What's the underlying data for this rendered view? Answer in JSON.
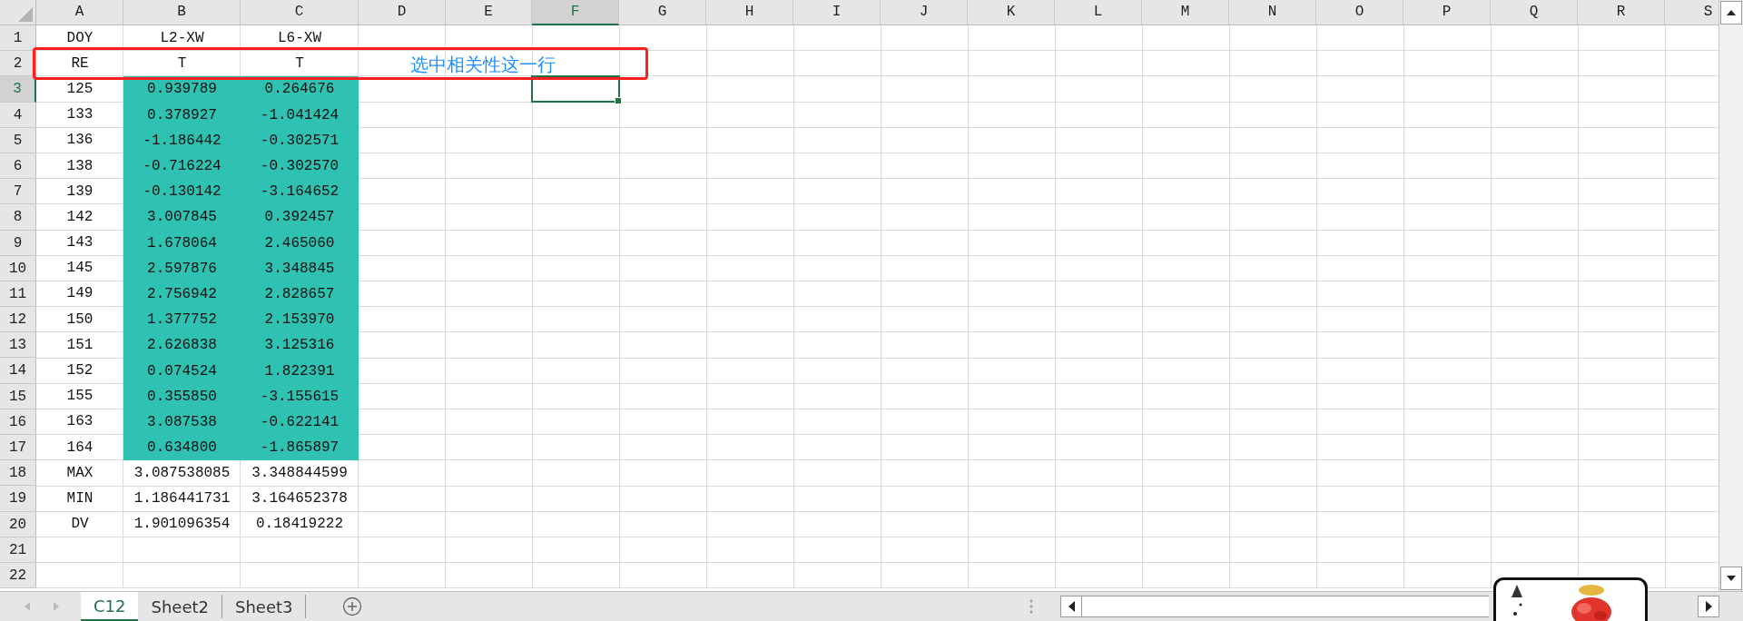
{
  "columns": [
    {
      "label": "A",
      "selected": false
    },
    {
      "label": "B",
      "selected": false
    },
    {
      "label": "C",
      "selected": false
    },
    {
      "label": "D",
      "selected": false
    },
    {
      "label": "E",
      "selected": false
    },
    {
      "label": "F",
      "selected": true
    },
    {
      "label": "G",
      "selected": false
    },
    {
      "label": "H",
      "selected": false
    },
    {
      "label": "I",
      "selected": false
    },
    {
      "label": "J",
      "selected": false
    },
    {
      "label": "K",
      "selected": false
    },
    {
      "label": "L",
      "selected": false
    },
    {
      "label": "M",
      "selected": false
    },
    {
      "label": "N",
      "selected": false
    },
    {
      "label": "O",
      "selected": false
    },
    {
      "label": "P",
      "selected": false
    },
    {
      "label": "Q",
      "selected": false
    },
    {
      "label": "R",
      "selected": false
    },
    {
      "label": "S",
      "selected": false
    }
  ],
  "rows": [
    {
      "label": "1",
      "selected": false,
      "cells": [
        {
          "text": "DOY",
          "filled": false
        },
        {
          "text": "L2-XW",
          "filled": false
        },
        {
          "text": "L6-XW",
          "filled": false
        }
      ]
    },
    {
      "label": "2",
      "selected": false,
      "cells": [
        {
          "text": "RE",
          "filled": false
        },
        {
          "text": "T",
          "filled": false
        },
        {
          "text": "T",
          "filled": false
        }
      ]
    },
    {
      "label": "3",
      "selected": true,
      "cells": [
        {
          "text": "125",
          "filled": false
        },
        {
          "text": "0.939789",
          "filled": true
        },
        {
          "text": "0.264676",
          "filled": true
        }
      ]
    },
    {
      "label": "4",
      "selected": false,
      "cells": [
        {
          "text": "133",
          "filled": false
        },
        {
          "text": "0.378927",
          "filled": true
        },
        {
          "text": "-1.041424",
          "filled": true
        }
      ]
    },
    {
      "label": "5",
      "selected": false,
      "cells": [
        {
          "text": "136",
          "filled": false
        },
        {
          "text": "-1.186442",
          "filled": true
        },
        {
          "text": "-0.302571",
          "filled": true
        }
      ]
    },
    {
      "label": "6",
      "selected": false,
      "cells": [
        {
          "text": "138",
          "filled": false
        },
        {
          "text": "-0.716224",
          "filled": true
        },
        {
          "text": "-0.302570",
          "filled": true
        }
      ]
    },
    {
      "label": "7",
      "selected": false,
      "cells": [
        {
          "text": "139",
          "filled": false
        },
        {
          "text": "-0.130142",
          "filled": true
        },
        {
          "text": "-3.164652",
          "filled": true
        }
      ]
    },
    {
      "label": "8",
      "selected": false,
      "cells": [
        {
          "text": "142",
          "filled": false
        },
        {
          "text": "3.007845",
          "filled": true
        },
        {
          "text": "0.392457",
          "filled": true
        }
      ]
    },
    {
      "label": "9",
      "selected": false,
      "cells": [
        {
          "text": "143",
          "filled": false
        },
        {
          "text": "1.678064",
          "filled": true
        },
        {
          "text": "2.465060",
          "filled": true
        }
      ]
    },
    {
      "label": "10",
      "selected": false,
      "cells": [
        {
          "text": "145",
          "filled": false
        },
        {
          "text": "2.597876",
          "filled": true
        },
        {
          "text": "3.348845",
          "filled": true
        }
      ]
    },
    {
      "label": "11",
      "selected": false,
      "cells": [
        {
          "text": "149",
          "filled": false
        },
        {
          "text": "2.756942",
          "filled": true
        },
        {
          "text": "2.828657",
          "filled": true
        }
      ]
    },
    {
      "label": "12",
      "selected": false,
      "cells": [
        {
          "text": "150",
          "filled": false
        },
        {
          "text": "1.377752",
          "filled": true
        },
        {
          "text": "2.153970",
          "filled": true
        }
      ]
    },
    {
      "label": "13",
      "selected": false,
      "cells": [
        {
          "text": "151",
          "filled": false
        },
        {
          "text": "2.626838",
          "filled": true
        },
        {
          "text": "3.125316",
          "filled": true
        }
      ]
    },
    {
      "label": "14",
      "selected": false,
      "cells": [
        {
          "text": "152",
          "filled": false
        },
        {
          "text": "0.074524",
          "filled": true
        },
        {
          "text": "1.822391",
          "filled": true
        }
      ]
    },
    {
      "label": "15",
      "selected": false,
      "cells": [
        {
          "text": "155",
          "filled": false
        },
        {
          "text": "0.355850",
          "filled": true
        },
        {
          "text": "-3.155615",
          "filled": true
        }
      ]
    },
    {
      "label": "16",
      "selected": false,
      "cells": [
        {
          "text": "163",
          "filled": false
        },
        {
          "text": "3.087538",
          "filled": true
        },
        {
          "text": "-0.622141",
          "filled": true
        }
      ]
    },
    {
      "label": "17",
      "selected": false,
      "cells": [
        {
          "text": "164",
          "filled": false
        },
        {
          "text": "0.634800",
          "filled": true
        },
        {
          "text": "-1.865897",
          "filled": true
        }
      ]
    },
    {
      "label": "18",
      "selected": false,
      "cells": [
        {
          "text": "MAX",
          "filled": false
        },
        {
          "text": "3.087538085",
          "filled": false
        },
        {
          "text": "3.348844599",
          "filled": false
        }
      ]
    },
    {
      "label": "19",
      "selected": false,
      "cells": [
        {
          "text": "MIN",
          "filled": false
        },
        {
          "text": "1.186441731",
          "filled": false
        },
        {
          "text": "3.164652378",
          "filled": false
        }
      ]
    },
    {
      "label": "20",
      "selected": false,
      "cells": [
        {
          "text": "DV",
          "filled": false
        },
        {
          "text": "1.901096354",
          "filled": false
        },
        {
          "text": "0.18419222",
          "filled": false
        }
      ]
    },
    {
      "label": "21",
      "selected": false,
      "cells": []
    },
    {
      "label": "22",
      "selected": false,
      "cells": []
    }
  ],
  "annotation": {
    "text": "选中相关性这一行"
  },
  "sheet_tabs": [
    {
      "label": "C12",
      "selected": true
    },
    {
      "label": "Sheet2",
      "selected": false
    },
    {
      "label": "Sheet3",
      "selected": false
    }
  ]
}
